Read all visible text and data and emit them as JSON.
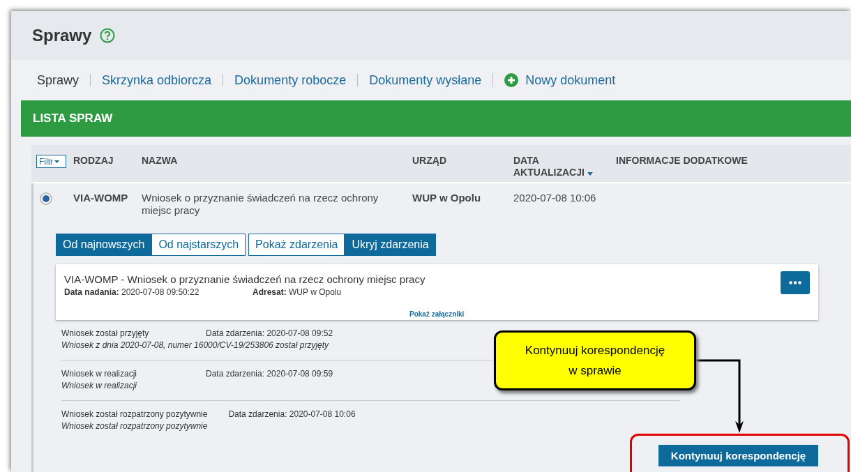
{
  "page": {
    "title": "Sprawy"
  },
  "nav": [
    {
      "label": "Sprawy",
      "selected": true,
      "kind": "link"
    },
    {
      "label": "Skrzynka odbiorcza",
      "selected": false,
      "kind": "link"
    },
    {
      "label": "Dokumenty robocze",
      "selected": false,
      "kind": "link"
    },
    {
      "label": "Dokumenty wysłane",
      "selected": false,
      "kind": "link"
    },
    {
      "label": "Nowy dokument",
      "selected": false,
      "kind": "action"
    }
  ],
  "section_title": "LISTA SPRAW",
  "table": {
    "filter_button": "Filtr",
    "columns": [
      {
        "label": "RODZAJ",
        "sorted": false
      },
      {
        "label": "NAZWA",
        "sorted": false
      },
      {
        "label": "URZĄD",
        "sorted": false
      },
      {
        "label": "DATA AKTUALIZACJI",
        "sorted": true
      },
      {
        "label": "INFORMACJE DODATKOWE",
        "sorted": false
      }
    ],
    "rows": [
      {
        "selected": true,
        "expanded": true,
        "type": "VIA-WOMP",
        "name": "Wniosek o przyznanie świadczeń na rzecz ochrony miejsc pracy",
        "office": "WUP w Opolu",
        "updated": "2020-07-08 10:06",
        "sort_buttons": [
          {
            "label": "Od najnowszych",
            "selected": true
          },
          {
            "label": "Od najstarszych",
            "selected": false
          }
        ],
        "event_buttons": [
          {
            "label": "Pokaż zdarzenia",
            "selected": false
          },
          {
            "label": "Ukryj zdarzenia",
            "selected": true
          }
        ],
        "document": {
          "title": "VIA-WOMP - Wniosek o przyznanie świadczeń na rzecz ochrony miejsc pracy",
          "sent": "**Data nadania:** 2020-07-08 09:50:22",
          "addressee": "**Adresat:** WUP w Opolu",
          "attachments_link": "Pokaż załączniki"
        },
        "events": [
          {
            "name": "Wniosek został przyjęty",
            "date": "Data zdarzenia: 2020-07-08 09:52",
            "description": "Wniosek z dnia 2020-07-08, numer 16000/CV-19/253806 został przyjęty"
          },
          {
            "name": "Wniosek w realizacji",
            "date": "Data zdarzenia: 2020-07-08 09:59",
            "description": "Wniosek w realizacji"
          },
          {
            "name": "Wniosek został rozpatrzony pozytywnie",
            "date": "Data zdarzenia: 2020-07-08 10:06",
            "description": "Wniosek został rozpatrzony pozytywnie"
          }
        ],
        "continue_button": "Kontynuuj korespondencję"
      }
    ]
  },
  "callout": "Kontynuuj korespondencję w sprawie"
}
